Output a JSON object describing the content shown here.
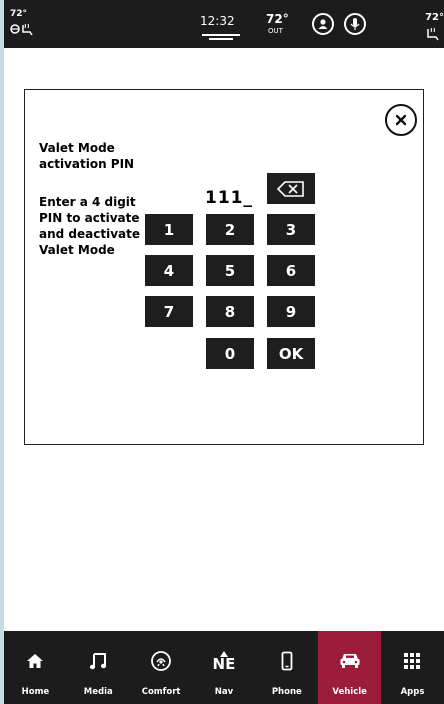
{
  "status": {
    "left_temp": "72°",
    "clock": "12:32",
    "out_temp": "72°",
    "out_label": "OUT",
    "right_temp": "72°"
  },
  "dialog": {
    "title": "Valet Mode activation PIN",
    "instructions": "Enter a 4 digit PIN to activate and deactivate Valet Mode",
    "pin_value": "111_",
    "keys": [
      "1",
      "2",
      "3",
      "4",
      "5",
      "6",
      "7",
      "8",
      "9",
      "0",
      "OK"
    ]
  },
  "nav": {
    "items": [
      {
        "label": "Home",
        "icon": "home-icon"
      },
      {
        "label": "Media",
        "icon": "music-note-icon"
      },
      {
        "label": "Comfort",
        "icon": "climate-icon"
      },
      {
        "label": "Nav",
        "icon": "compass-icon",
        "heading": "NE"
      },
      {
        "label": "Phone",
        "icon": "phone-icon"
      },
      {
        "label": "Vehicle",
        "icon": "car-icon",
        "active": true
      },
      {
        "label": "Apps",
        "icon": "apps-grid-icon"
      }
    ]
  },
  "colors": {
    "active_tab": "#9b1b3a",
    "bar": "#1c1c1c",
    "key": "#1e1e1e"
  }
}
